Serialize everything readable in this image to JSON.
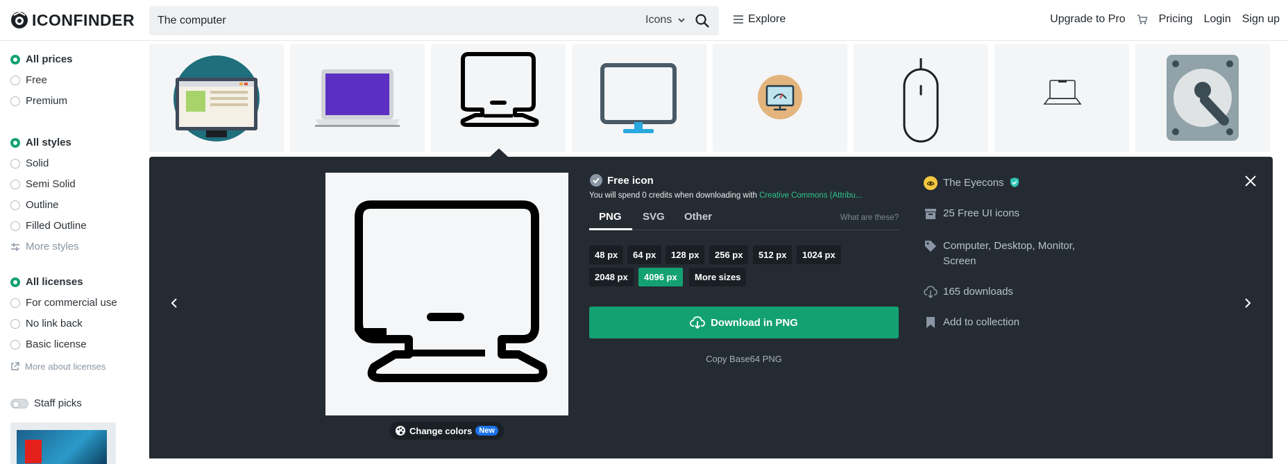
{
  "header": {
    "logo_text": "ICONFINDER",
    "search": {
      "value": "The computer",
      "type_label": "Icons"
    },
    "explore_label": "Explore",
    "upgrade_label": "Upgrade to Pro",
    "pricing_label": "Pricing",
    "login_label": "Login",
    "signup_label": "Sign up"
  },
  "sidebar": {
    "prices": [
      "All prices",
      "Free",
      "Premium"
    ],
    "styles": [
      "All styles",
      "Solid",
      "Semi Solid",
      "Outline",
      "Filled Outline"
    ],
    "more_styles": "More styles",
    "licenses": [
      "All licenses",
      "For commercial use",
      "No link back",
      "Basic license"
    ],
    "more_licenses": "More about licenses",
    "staff_picks": "Staff picks",
    "selected": {
      "price": "All prices",
      "style": "All styles",
      "license": "All licenses"
    }
  },
  "detail": {
    "free_label": "Free icon",
    "credits_prefix": "You will spend 0 credits when downloading with ",
    "credits_license": "Creative Commons (Attribu...",
    "formats": [
      "PNG",
      "SVG",
      "Other"
    ],
    "active_format": "PNG",
    "formats_help": "What are these?",
    "sizes": [
      "48 px",
      "64 px",
      "128 px",
      "256 px",
      "512 px",
      "1024 px",
      "2048 px",
      "4096 px",
      "More sizes"
    ],
    "active_size": "4096 px",
    "download_label": "Download in PNG",
    "copy_label": "Copy Base64 PNG",
    "change_colors_label": "Change colors",
    "new_badge": "New",
    "author": "The Eyecons",
    "iconset": "25 Free UI icons",
    "tags": "Computer, Desktop, Monitor, Screen",
    "downloads": "165 downloads",
    "add_collection": "Add to collection"
  },
  "colors": {
    "accent": "#13a172",
    "panel": "#252b32",
    "license_link": "#2fc48b",
    "new_badge": "#1a73e8"
  }
}
